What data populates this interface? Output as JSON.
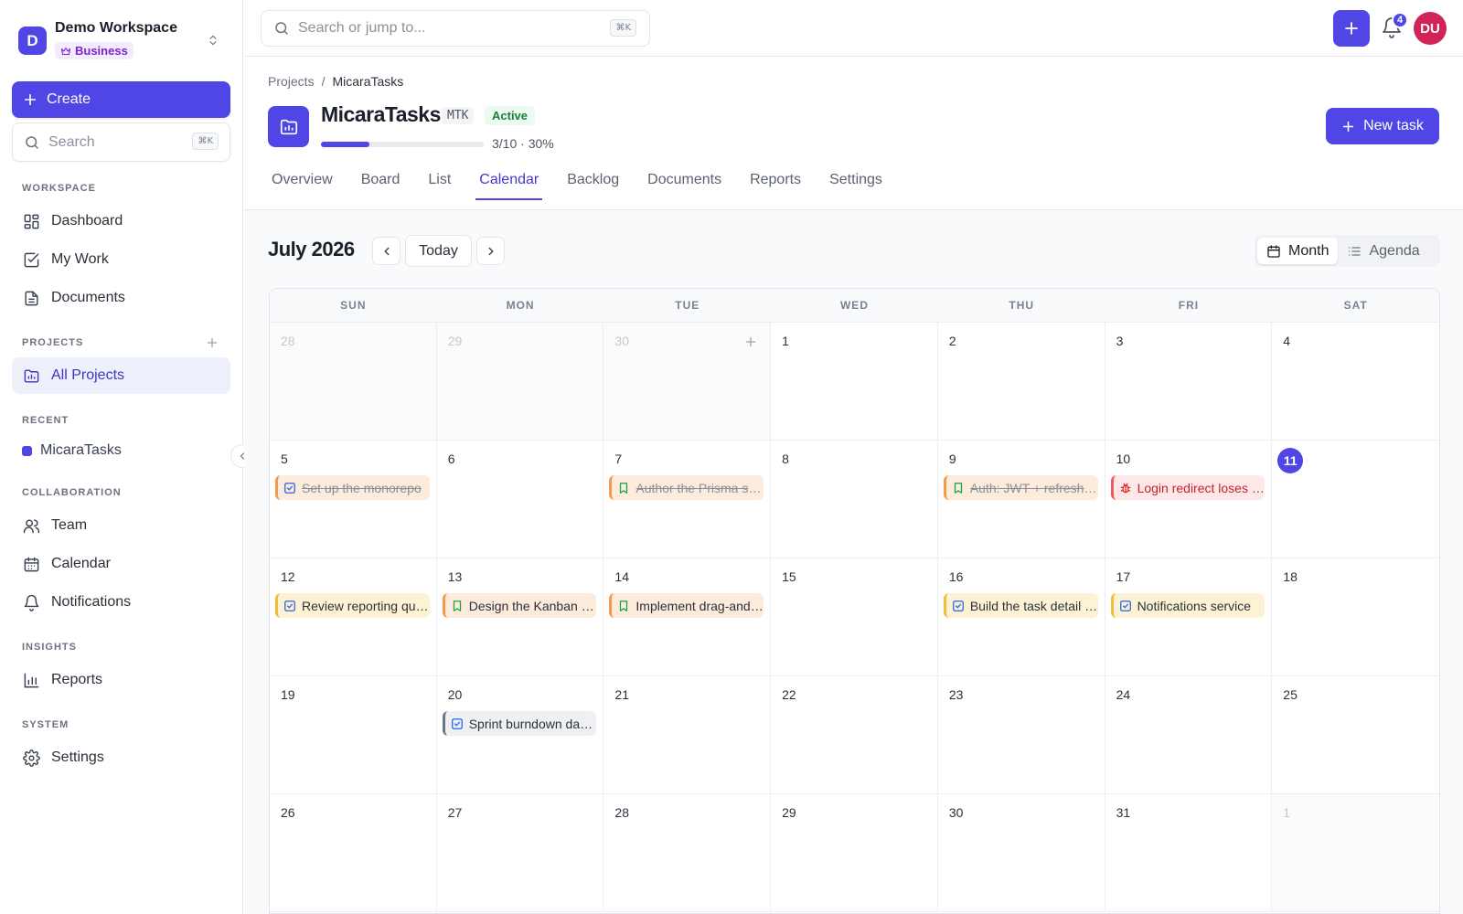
{
  "workspace": {
    "initial": "D",
    "name": "Demo Workspace",
    "plan": "Business"
  },
  "sidebar": {
    "create_label": "Create",
    "search_placeholder": "Search",
    "search_shortcut": "⌘K",
    "sections": {
      "workspace": "WORKSPACE",
      "projects": "PROJECTS",
      "recent": "RECENT",
      "collaboration": "COLLABORATION",
      "insights": "INSIGHTS",
      "system": "SYSTEM"
    },
    "items": {
      "dashboard": "Dashboard",
      "my_work": "My Work",
      "documents": "Documents",
      "all_projects": "All Projects",
      "team": "Team",
      "calendar": "Calendar",
      "notifications": "Notifications",
      "reports": "Reports",
      "settings": "Settings"
    },
    "recent_project": "MicaraTasks"
  },
  "topbar": {
    "search_placeholder": "Search or jump to...",
    "search_shortcut": "⌘K",
    "notification_count": "4",
    "user_initials": "DU"
  },
  "project": {
    "breadcrumb_root": "Projects",
    "breadcrumb_sep": "/",
    "breadcrumb_current": "MicaraTasks",
    "name": "MicaraTasks",
    "key": "MTK",
    "status": "Active",
    "progress_fraction": 0.3,
    "progress_text": "3/10 · 30%",
    "new_task_label": "New task",
    "tabs": [
      "Overview",
      "Board",
      "List",
      "Calendar",
      "Backlog",
      "Documents",
      "Reports",
      "Settings"
    ],
    "active_tab": "Calendar"
  },
  "calendar": {
    "month_label": "July 2026",
    "today_label": "Today",
    "views": {
      "month": "Month",
      "agenda": "Agenda"
    },
    "active_view": "Month",
    "weekdays": [
      "SUN",
      "MON",
      "TUE",
      "WED",
      "THU",
      "FRI",
      "SAT"
    ],
    "today": "11",
    "days": [
      {
        "n": "28",
        "other": true
      },
      {
        "n": "29",
        "other": true
      },
      {
        "n": "30",
        "other": true,
        "add": true
      },
      {
        "n": "1"
      },
      {
        "n": "2"
      },
      {
        "n": "3"
      },
      {
        "n": "4"
      },
      {
        "n": "5",
        "task": {
          "title": "Set up the monorepo",
          "icon": "task-icon",
          "color": "orange",
          "done": true
        }
      },
      {
        "n": "6"
      },
      {
        "n": "7",
        "task": {
          "title": "Author the Prisma schema",
          "icon": "story-icon",
          "color": "orange",
          "done": true
        }
      },
      {
        "n": "8"
      },
      {
        "n": "9",
        "task": {
          "title": "Auth: JWT + refresh tokens",
          "icon": "story-icon",
          "color": "orange",
          "done": true
        }
      },
      {
        "n": "10",
        "task": {
          "title": "Login redirect loses state",
          "icon": "bug-icon",
          "color": "red",
          "done": false
        }
      },
      {
        "n": "11",
        "today": true
      },
      {
        "n": "12",
        "task": {
          "title": "Review reporting queries",
          "icon": "task-icon",
          "color": "amber",
          "done": false
        }
      },
      {
        "n": "13",
        "task": {
          "title": "Design the Kanban board",
          "icon": "story-icon",
          "color": "orange",
          "done": false
        }
      },
      {
        "n": "14",
        "task": {
          "title": "Implement drag-and-drop",
          "icon": "story-icon",
          "color": "orange",
          "done": false
        }
      },
      {
        "n": "15"
      },
      {
        "n": "16",
        "task": {
          "title": "Build the task detail view",
          "icon": "task-icon",
          "color": "amber",
          "done": false
        }
      },
      {
        "n": "17",
        "task": {
          "title": "Notifications service",
          "icon": "task-icon",
          "color": "amber",
          "done": false
        }
      },
      {
        "n": "18"
      },
      {
        "n": "19"
      },
      {
        "n": "20",
        "task": {
          "title": "Sprint burndown dashboard",
          "icon": "task-icon",
          "color": "slate",
          "done": false
        }
      },
      {
        "n": "21"
      },
      {
        "n": "22"
      },
      {
        "n": "23"
      },
      {
        "n": "24"
      },
      {
        "n": "25"
      },
      {
        "n": "26"
      },
      {
        "n": "27"
      },
      {
        "n": "28"
      },
      {
        "n": "29"
      },
      {
        "n": "30"
      },
      {
        "n": "31"
      },
      {
        "n": "1",
        "other": true
      }
    ]
  }
}
